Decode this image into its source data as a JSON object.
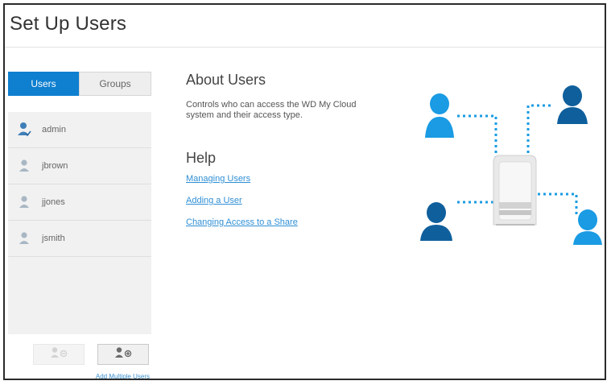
{
  "page": {
    "title": "Set Up Users"
  },
  "sidebar": {
    "tabs": [
      {
        "label": "Users",
        "active": true
      },
      {
        "label": "Groups",
        "active": false
      }
    ],
    "users": [
      {
        "name": "admin",
        "icon": "admin-user-icon"
      },
      {
        "name": "jbrown",
        "icon": "user-icon"
      },
      {
        "name": "jjones",
        "icon": "user-icon"
      },
      {
        "name": "jsmith",
        "icon": "user-icon"
      }
    ],
    "actions": [
      {
        "icon": "remove-user-icon",
        "enabled": false
      },
      {
        "icon": "add-user-icon",
        "enabled": true
      }
    ],
    "add_multiple_label": "Add Multiple Users"
  },
  "about": {
    "title": "About Users",
    "description": "Controls who can access the WD My Cloud system and their access type."
  },
  "help": {
    "title": "Help",
    "links": [
      "Managing Users",
      "Adding a User",
      "Changing Access to a Share"
    ]
  },
  "colors": {
    "accent": "#0f7fcf",
    "illustration_blue": "#1a9be3",
    "link": "#2f8fd6"
  }
}
